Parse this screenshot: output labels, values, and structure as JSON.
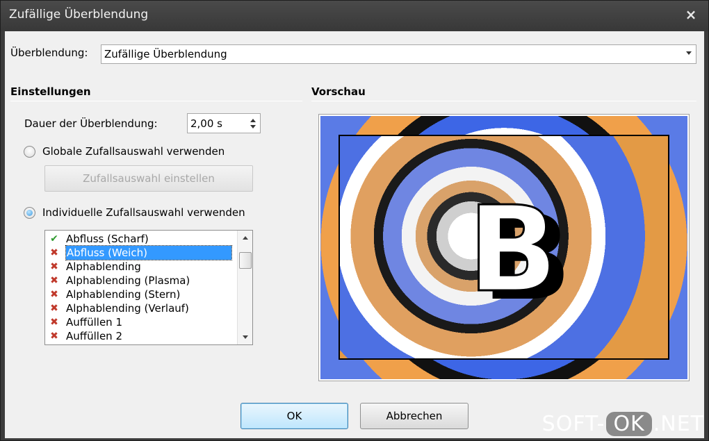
{
  "window": {
    "title": "Zufällige Überblendung",
    "close_glyph": "×"
  },
  "transition": {
    "label": "Überblendung:",
    "value": "Zufällige Überblendung"
  },
  "settings": {
    "title": "Einstellungen",
    "duration_label": "Dauer der Überblendung:",
    "duration_value": "2,00 s",
    "global_random_label": "Globale Zufallsauswahl verwenden",
    "global_random_selected": false,
    "configure_button": "Zufallsauswahl einstellen",
    "individual_random_label": "Individuelle Zufallsauswahl verwenden",
    "individual_random_selected": true
  },
  "list": {
    "items": [
      {
        "label": "Abfluss (Scharf)",
        "state": "check"
      },
      {
        "label": "Abfluss (Weich)",
        "state": "cross",
        "selected": true
      },
      {
        "label": "Alphablending",
        "state": "cross"
      },
      {
        "label": "Alphablending (Plasma)",
        "state": "cross"
      },
      {
        "label": "Alphablending (Stern)",
        "state": "cross"
      },
      {
        "label": "Alphablending (Verlauf)",
        "state": "cross"
      },
      {
        "label": "Auffüllen 1",
        "state": "cross"
      },
      {
        "label": "Auffüllen 2",
        "state": "cross"
      }
    ]
  },
  "preview": {
    "title": "Vorschau",
    "letter": "B"
  },
  "buttons": {
    "ok": "OK",
    "cancel": "Abbrechen"
  },
  "watermark": {
    "left": "SOFT-",
    "middle": "OK",
    "right": ".NET"
  },
  "icons": {
    "check": "✔",
    "cross": "✖"
  }
}
